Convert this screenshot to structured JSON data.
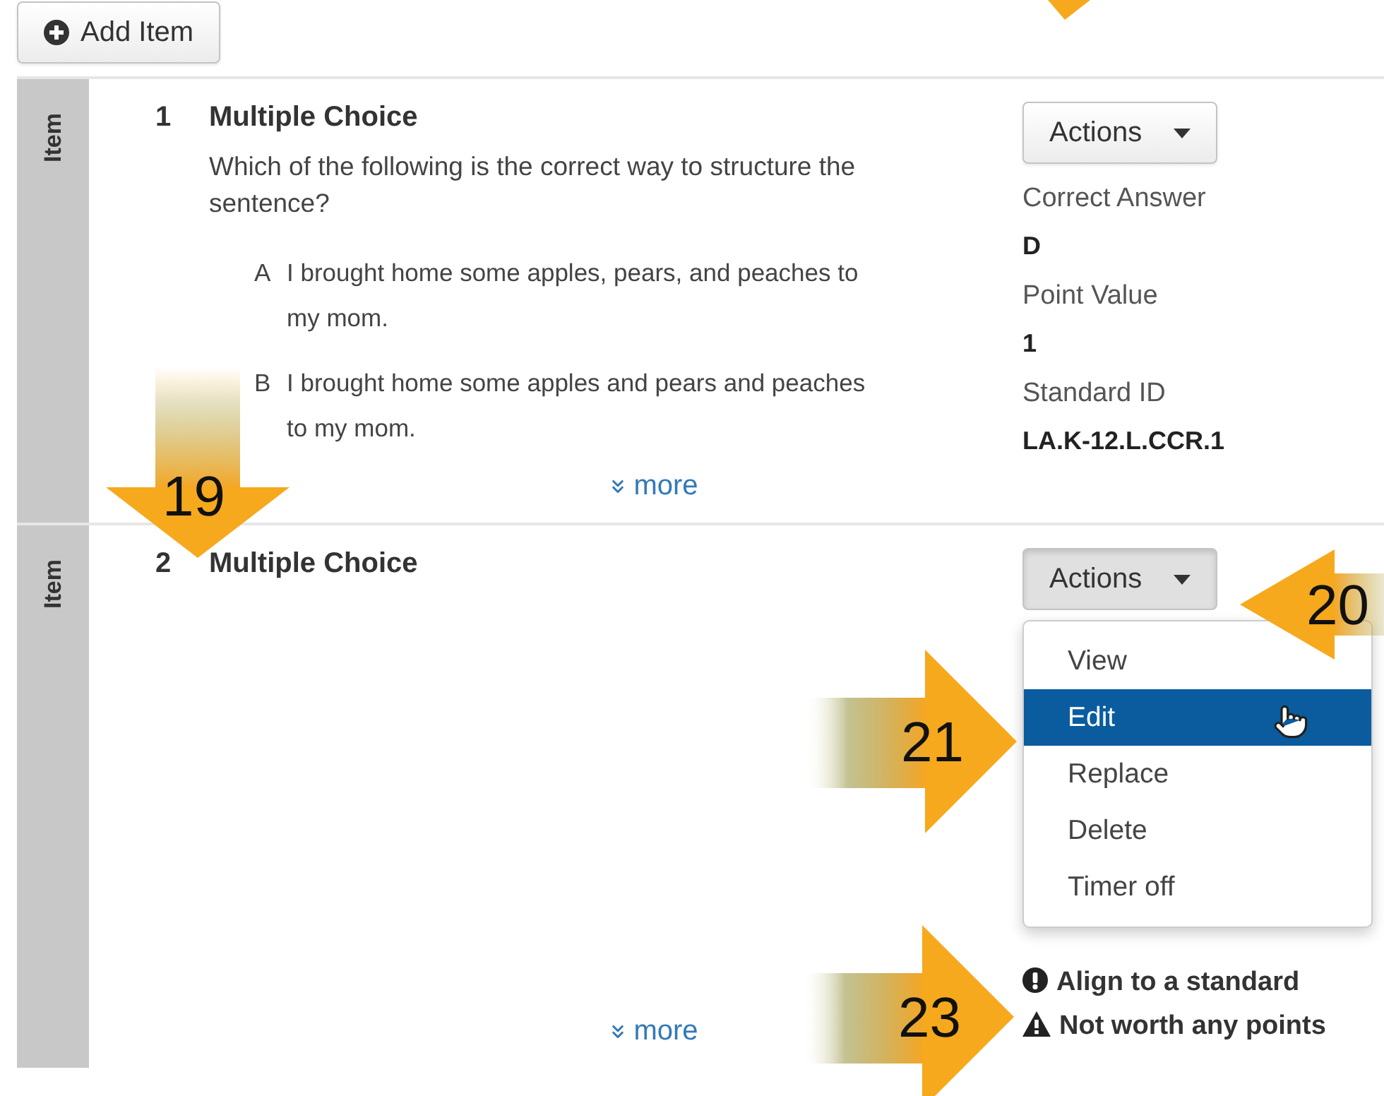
{
  "toolbar": {
    "add_button": "Add Item"
  },
  "items": [
    {
      "side_label": "Item",
      "number": "1",
      "type": "Multiple Choice",
      "question": "Which of the following is the correct way to structure the sentence?",
      "options": [
        {
          "letter": "A",
          "text": "I brought home some apples, pears, and peaches to my mom."
        },
        {
          "letter": "B",
          "text": "I brought home some apples and pears and peaches to my mom."
        }
      ],
      "more": "more",
      "actions": {
        "label": "Actions",
        "pressed": false
      },
      "details": [
        {
          "label": "Correct Answer",
          "value": "D"
        },
        {
          "label": "Point Value",
          "value": "1"
        },
        {
          "label": "Standard ID",
          "value": "LA.K-12.L.CCR.1"
        }
      ]
    },
    {
      "side_label": "Item",
      "number": "2",
      "type": "Multiple Choice",
      "more": "more",
      "actions": {
        "label": "Actions",
        "pressed": true
      },
      "menu": [
        {
          "label": "View",
          "selected": false
        },
        {
          "label": "Edit",
          "selected": true
        },
        {
          "label": "Replace",
          "selected": false
        },
        {
          "label": "Delete",
          "selected": false
        },
        {
          "label": "Timer off",
          "selected": false
        }
      ],
      "warnings": [
        {
          "kind": "info",
          "text": "Align to a standard"
        },
        {
          "kind": "warning",
          "text": "Not worth any points"
        }
      ]
    }
  ],
  "callouts": [
    {
      "number": "19",
      "kind": "down"
    },
    {
      "number": "20",
      "kind": "left"
    },
    {
      "number": "21",
      "kind": "right"
    },
    {
      "number": "23",
      "kind": "right"
    },
    {
      "kind": "tip"
    }
  ]
}
